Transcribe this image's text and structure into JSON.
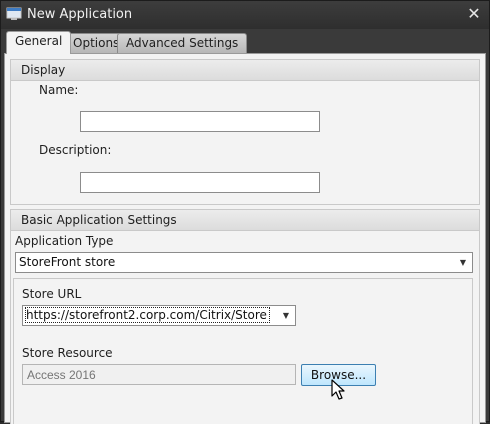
{
  "window": {
    "title": "New Application",
    "close_glyph": "✕"
  },
  "tabs": [
    {
      "label": "General",
      "active": true
    },
    {
      "label": "Options",
      "active": false
    },
    {
      "label": "Advanced Settings",
      "active": false
    }
  ],
  "display_group": {
    "header": "Display",
    "name_label": "Name:",
    "name_value": "",
    "description_label": "Description:",
    "description_value": ""
  },
  "basic_group": {
    "header": "Basic Application Settings",
    "app_type_label": "Application Type",
    "app_type_value": "StoreFront store",
    "store_url_label": "Store URL",
    "store_url_value": "https://storefront2.corp.com/Citrix/Store",
    "store_resource_label": "Store Resource",
    "store_resource_placeholder": "Access 2016",
    "browse_label": "Browse..."
  },
  "icons": {
    "title_icon": "application-window-icon",
    "dropdown": "chevron-down-icon",
    "cursor": "mouse-pointer-icon"
  },
  "colors": {
    "titlebar": "#2e2e2e",
    "panel": "#f3f3f3",
    "button_border": "#3c7fb1",
    "button_fill": "#bee6fd"
  }
}
